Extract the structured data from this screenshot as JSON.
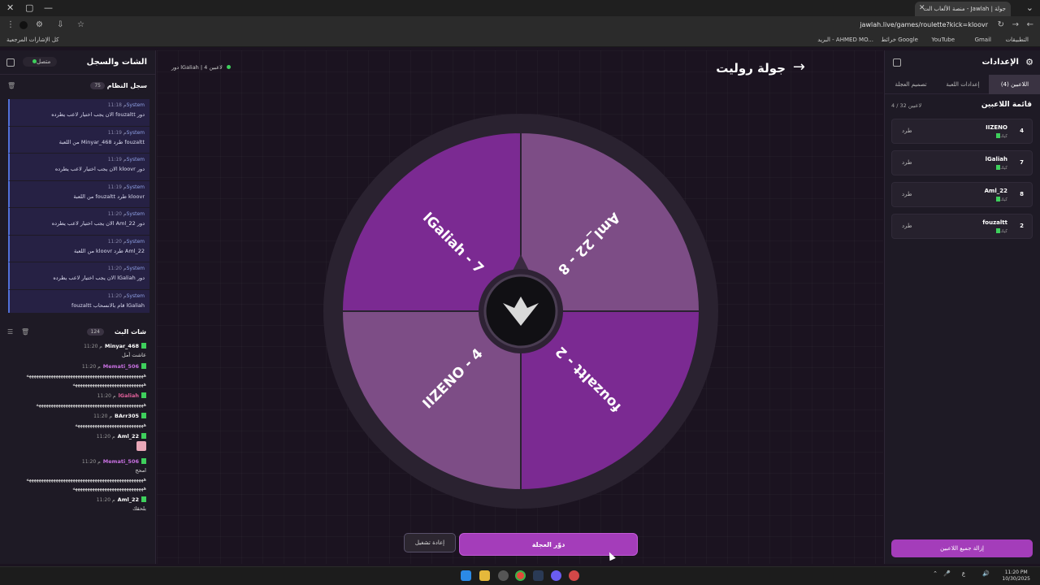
{
  "browser": {
    "tab_title": "جولة | Jawlah - منصة الألعاب الت",
    "url": "jawlah.live/games/roulette?kick=kloovr",
    "bookmarks": [
      "التطبيقات",
      "Gmail",
      "YouTube",
      "خرائط Google",
      "البريد - AHMED MO...",
      "كل الإشارات المرجعية"
    ]
  },
  "left_panel": {
    "title": "الشات والسجل",
    "status": "متصل",
    "system_log": {
      "title": "سجل النظام",
      "count": "75",
      "items": [
        {
          "sender": "System",
          "time": "11:18 م",
          "text": "دور fouzaltt الان يجب اختيار لاعب يطرده"
        },
        {
          "sender": "System",
          "time": "11:19 م",
          "text": "fouzaltt طرد Minyar_468 من اللعبة"
        },
        {
          "sender": "System",
          "time": "11:19 م",
          "text": "دور kloovr الان يجب اختيار لاعب يطرده"
        },
        {
          "sender": "System",
          "time": "11:19 م",
          "text": "kloovr طرد fouzaltt من اللعبة"
        },
        {
          "sender": "System",
          "time": "11:20 م",
          "text": "دور Aml_22 الان يجب اختيار لاعب يطرده"
        },
        {
          "sender": "System",
          "time": "11:20 م",
          "text": "Aml_22 طرد kloovr من اللعبة"
        },
        {
          "sender": "System",
          "time": "11:20 م",
          "text": "دور lGaliah الان يجب اختيار لاعب يطرده"
        },
        {
          "sender": "System",
          "time": "11:20 م",
          "text": "lGaliah قام بالانسحاب fouzaltt"
        }
      ]
    },
    "live_chat": {
      "title": "شات البث",
      "count": "124",
      "messages": [
        {
          "user": "Minyar_468",
          "time": "11:20 م",
          "text": "عاشت أمل",
          "color": "#ffffff"
        },
        {
          "user": "Memati_506",
          "time": "11:20 م",
          "text": "ههههههههههههههههههههههههههههههههههههههههههههههههه",
          "text2": "هههههههههههههههههههههههههههههه",
          "color": "#c770e0"
        },
        {
          "user": "lGaliah",
          "time": "11:20 م",
          "text": "ههههههههههههههههههههههههههههههههههههههههههههه",
          "color": "#e0609a"
        },
        {
          "user": "BArr305",
          "time": "11:20 م",
          "text": "ههههههههههههههههههههههههههههه",
          "color": "#ffffff"
        },
        {
          "user": "Aml_22",
          "time": "11:20 م",
          "text": "",
          "sticker": true,
          "color": "#ffffff"
        },
        {
          "user": "Memati_506",
          "time": "11:20 م",
          "text": "امحح",
          "text2": "ههههههههههههههههههههههههههههههههههههههههههههههههه",
          "text3": "هههههههههههههههههههههههههههههه",
          "color": "#c770e0"
        },
        {
          "user": "Aml_22",
          "time": "11:20 م",
          "text": "بلحقك",
          "color": "#ffffff"
        }
      ]
    }
  },
  "center": {
    "title": "جولة روليت",
    "players_count": "4 لاعبين",
    "turn_label": "دور lGaliah",
    "spin_button": "دوّر العجلة",
    "reset_button": "إعادة تشغيل",
    "wheel_segments": [
      {
        "label": "lGaliah - 7",
        "color": "#7b2a92"
      },
      {
        "label": "Aml_22 - 8",
        "color": "#7d4d86"
      },
      {
        "label": "fouzaltt - 2",
        "color": "#7b2a92"
      },
      {
        "label": "IIZENO - 4",
        "color": "#7d4d86"
      }
    ]
  },
  "right_panel": {
    "title": "الإعدادات",
    "tabs": [
      "اللاعبين (4)",
      "إعدادات اللعبة",
      "تصميم العجلة"
    ],
    "list_title": "قائمة اللاعبين",
    "list_count": "4 / 32 لاعبين",
    "platform": "كيك",
    "kick_label": "طرد",
    "players": [
      {
        "name": "IIZENO",
        "number": "4"
      },
      {
        "name": "lGaliah",
        "number": "7"
      },
      {
        "name": "Aml_22",
        "number": "8"
      },
      {
        "name": "fouzaltt",
        "number": "2"
      }
    ],
    "remove_all": "إزالة جميع اللاعبين"
  },
  "taskbar": {
    "time": "11:20 PM",
    "date": "10/30/2025",
    "lang": "ع"
  }
}
